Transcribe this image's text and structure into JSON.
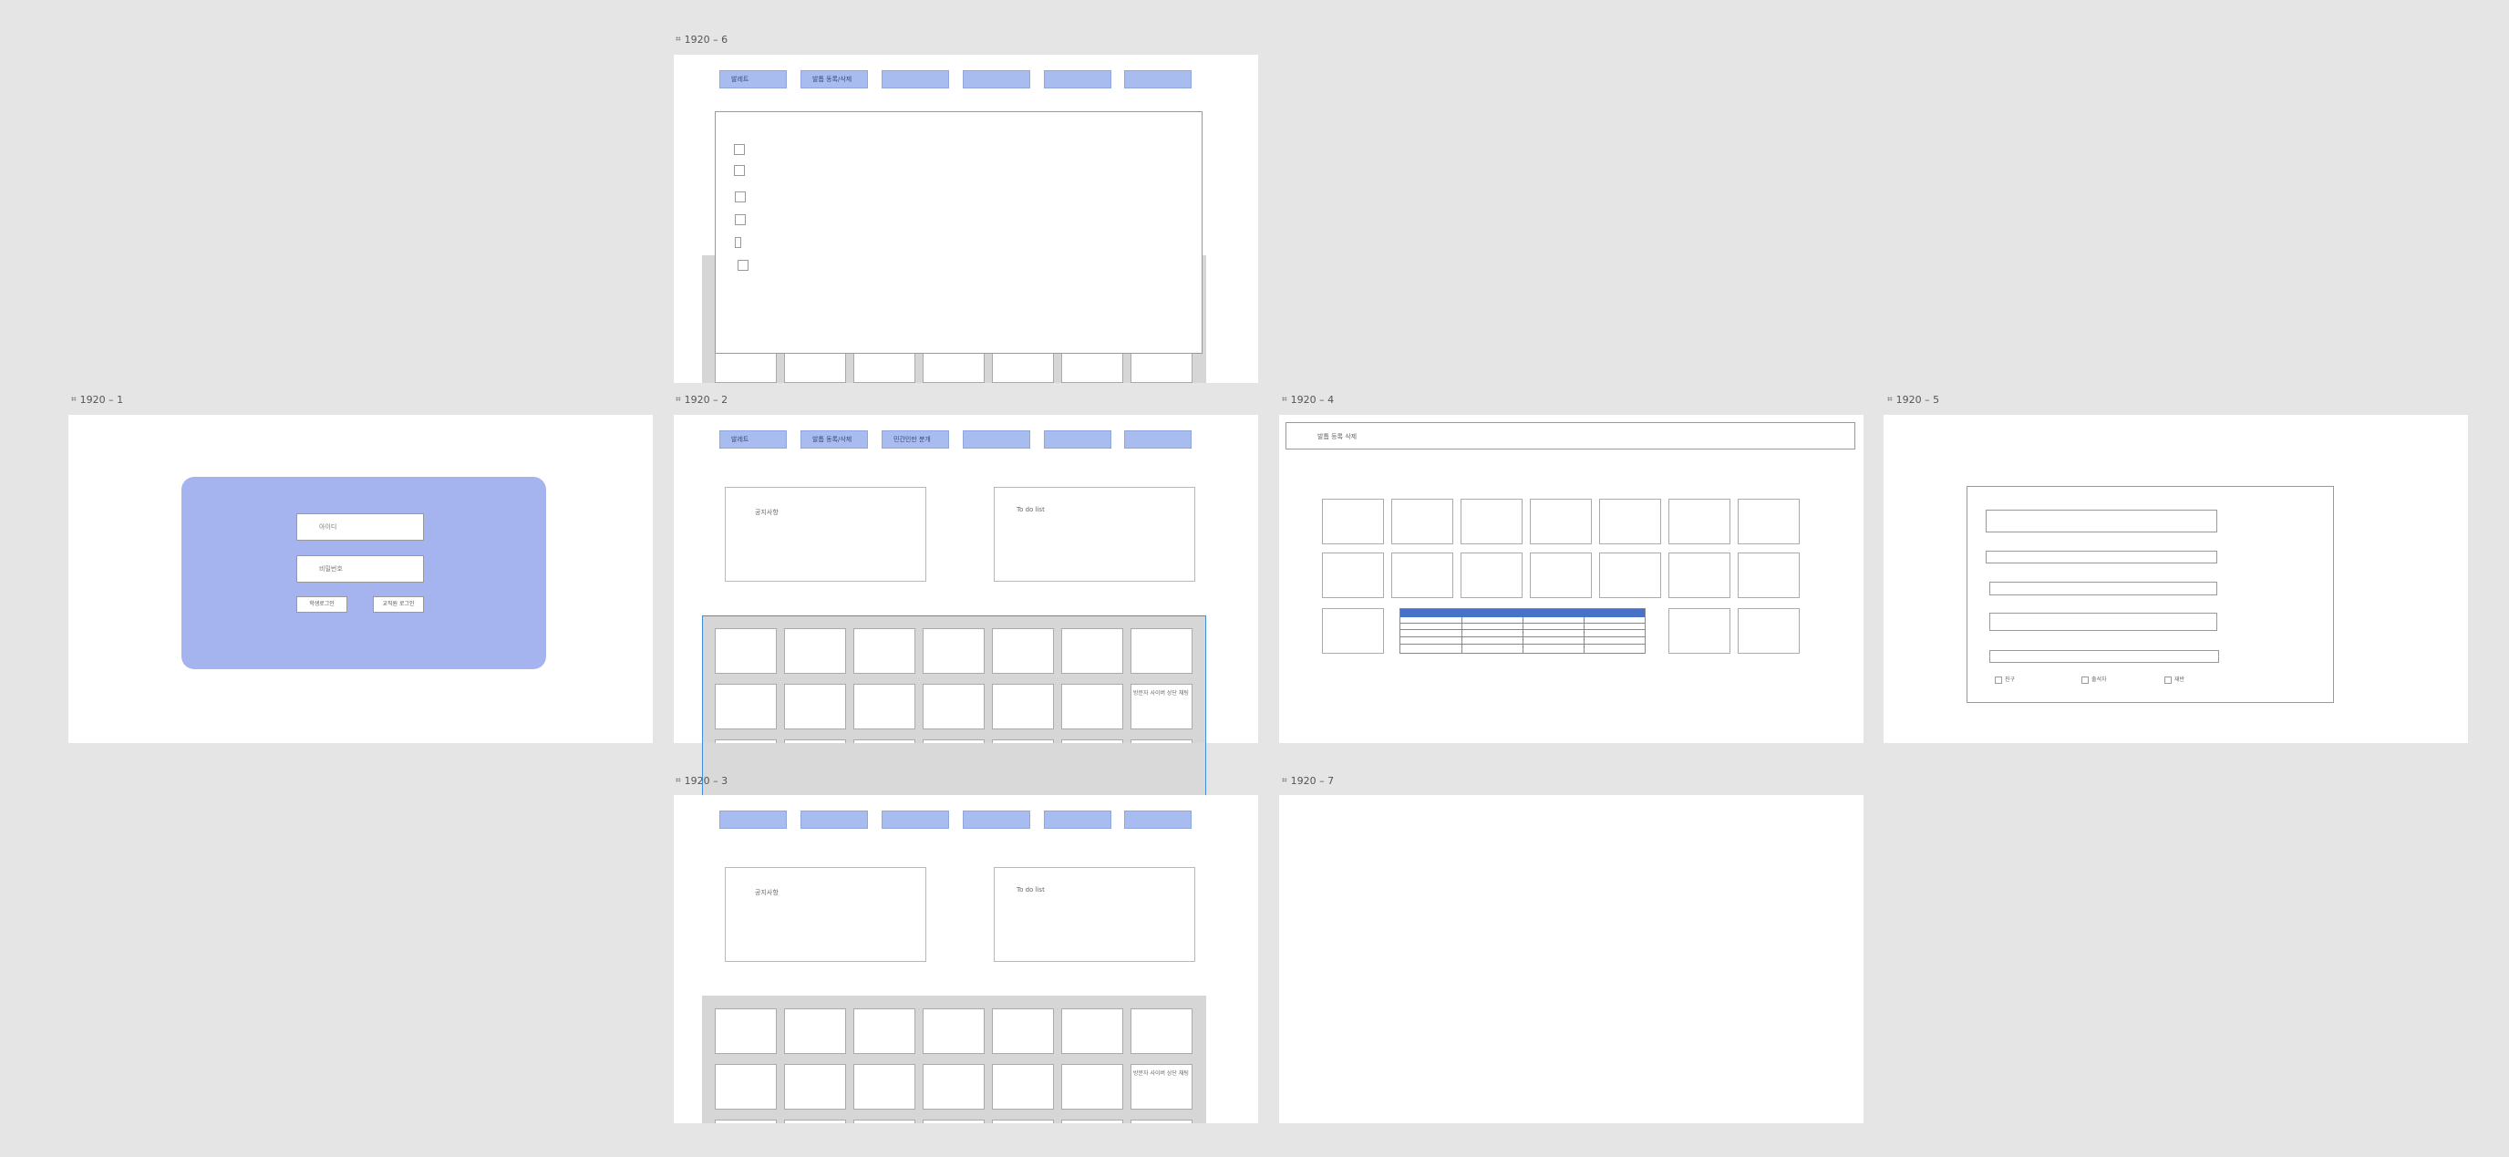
{
  "frames": {
    "f6": {
      "label": "1920 – 6",
      "nav": [
        "발레트",
        "발톱 동록/삭제",
        "",
        "",
        "",
        ""
      ]
    },
    "f1": {
      "label": "1920 – 1",
      "login": {
        "id_placeholder": "아이디",
        "pw_placeholder": "비밀번호",
        "student_login": "학생로그인",
        "teacher_login": "교직원 로그인"
      }
    },
    "f2": {
      "label": "1920 – 2",
      "nav": [
        "발레트",
        "발톱 동록/삭제",
        "민간인만 분개",
        "",
        "",
        ""
      ],
      "notice_title": "공지사항",
      "todo_title": "To do list",
      "cell_note": "방문자 사이버 상단 채팅"
    },
    "f4": {
      "label": "1920 – 4",
      "header_text": "발톱 등록 삭제"
    },
    "f5": {
      "label": "1920 – 5",
      "checkboxes": [
        "친구",
        "출석자",
        "재반"
      ]
    },
    "f3": {
      "label": "1920 – 3",
      "notice_title": "공지사항",
      "todo_title": "To do list",
      "cell_note": "방문자 사이버 상단 채팅"
    },
    "f7": {
      "label": "1920 – 7"
    }
  },
  "icons": {
    "frame": "frame-icon"
  }
}
